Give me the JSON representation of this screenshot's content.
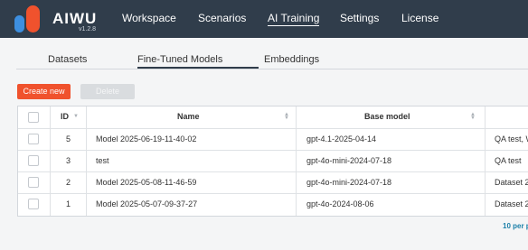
{
  "app": {
    "brand": "AIWU",
    "version": "v1.2.8"
  },
  "nav": [
    "Workspace",
    "Scenarios",
    "AI Training",
    "Settings",
    "License"
  ],
  "tabs": [
    "Datasets",
    "Fine-Tuned Models",
    "Embeddings"
  ],
  "toolbar": {
    "create_label": "Create new",
    "delete_label": "Delete"
  },
  "table": {
    "columns": [
      "ID",
      "Name",
      "Base model"
    ],
    "rows": [
      {
        "id": "5",
        "name": "Model 2025-06-19-11-40-02",
        "base": "gpt-4.1-2025-04-14",
        "extra": "QA test, W"
      },
      {
        "id": "3",
        "name": "test",
        "base": "gpt-4o-mini-2024-07-18",
        "extra": "QA test"
      },
      {
        "id": "2",
        "name": "Model 2025-05-08-11-46-59",
        "base": "gpt-4o-mini-2024-07-18",
        "extra": "Dataset 2"
      },
      {
        "id": "1",
        "name": "Model 2025-05-07-09-37-27",
        "base": "gpt-4o-2024-08-06",
        "extra": "Dataset 2"
      }
    ]
  },
  "pagination": {
    "per_page": "10 per p"
  },
  "colors": {
    "header_bg": "#303d4b",
    "accent": "#f0522d",
    "logo_blue": "#3d8fe0",
    "link": "#1a7fa8"
  }
}
